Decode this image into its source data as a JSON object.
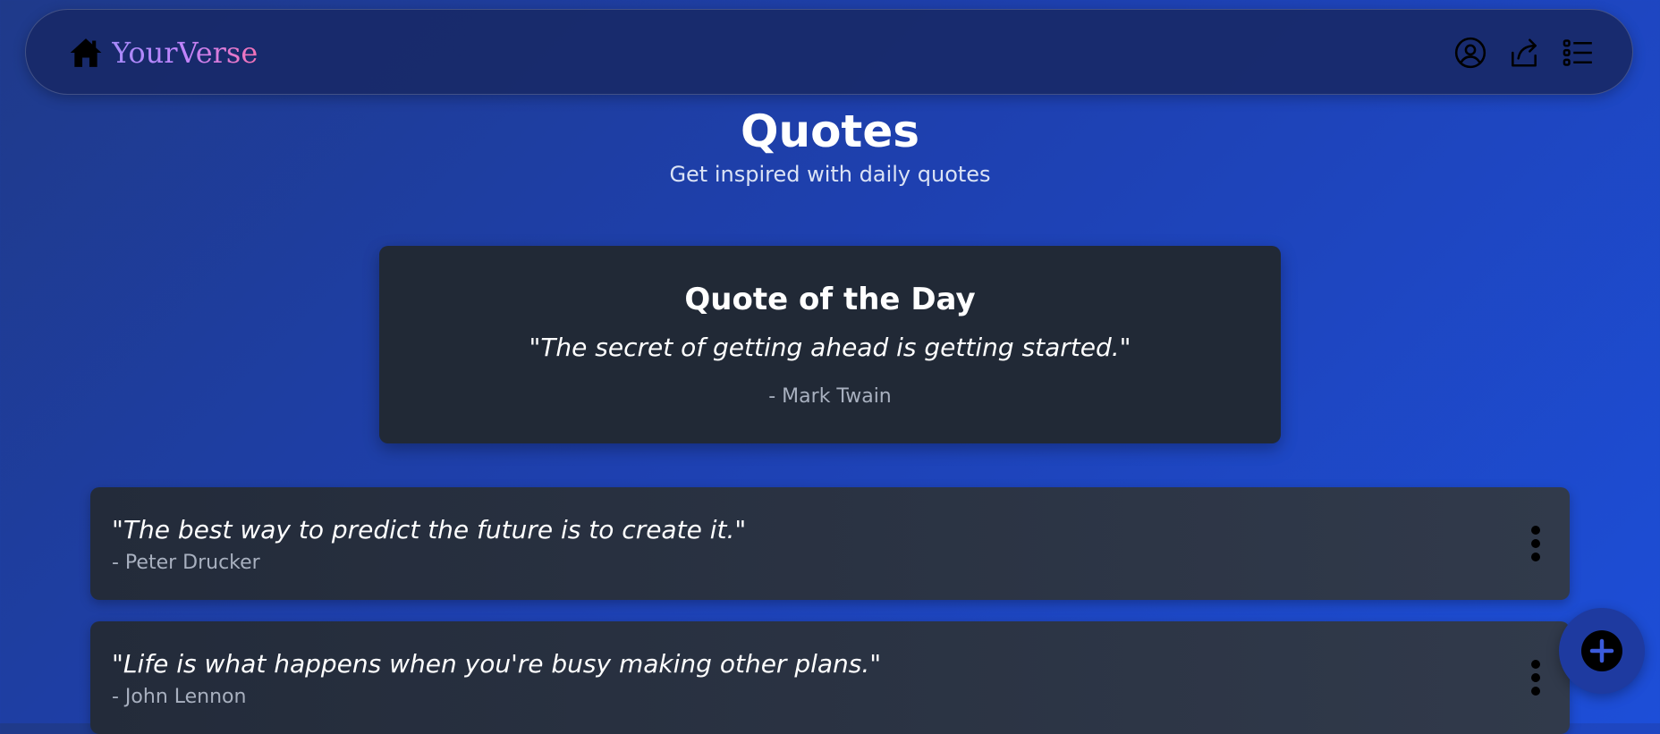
{
  "navbar": {
    "brand": "YourVerse",
    "home_icon": "home-icon",
    "icons": [
      "user-circle-icon",
      "share-icon",
      "list-icon"
    ]
  },
  "header": {
    "title": "Quotes",
    "subtitle": "Get inspired with daily quotes"
  },
  "quote_of_the_day": {
    "heading": "Quote of the Day",
    "text": "\"The secret of getting ahead is getting started.\"",
    "author": "- Mark Twain"
  },
  "quotes": [
    {
      "text": "\"The best way to predict the future is to create it.\"",
      "author": "- Peter Drucker",
      "menu_icon": "more-vertical-icon"
    },
    {
      "text": "\"Life is what happens when you're busy making other plans.\"",
      "author": "- John Lennon",
      "menu_icon": "more-vertical-icon"
    }
  ],
  "fab": {
    "icon": "plus-icon"
  },
  "colors": {
    "background_start": "#1f3a8a",
    "background_end": "#1d4ed8",
    "navbar": "#182968",
    "card": "#212936",
    "brand_gradient_start": "#a78bfa",
    "brand_gradient_end": "#f472b6",
    "muted_text": "#a8b0bf"
  }
}
